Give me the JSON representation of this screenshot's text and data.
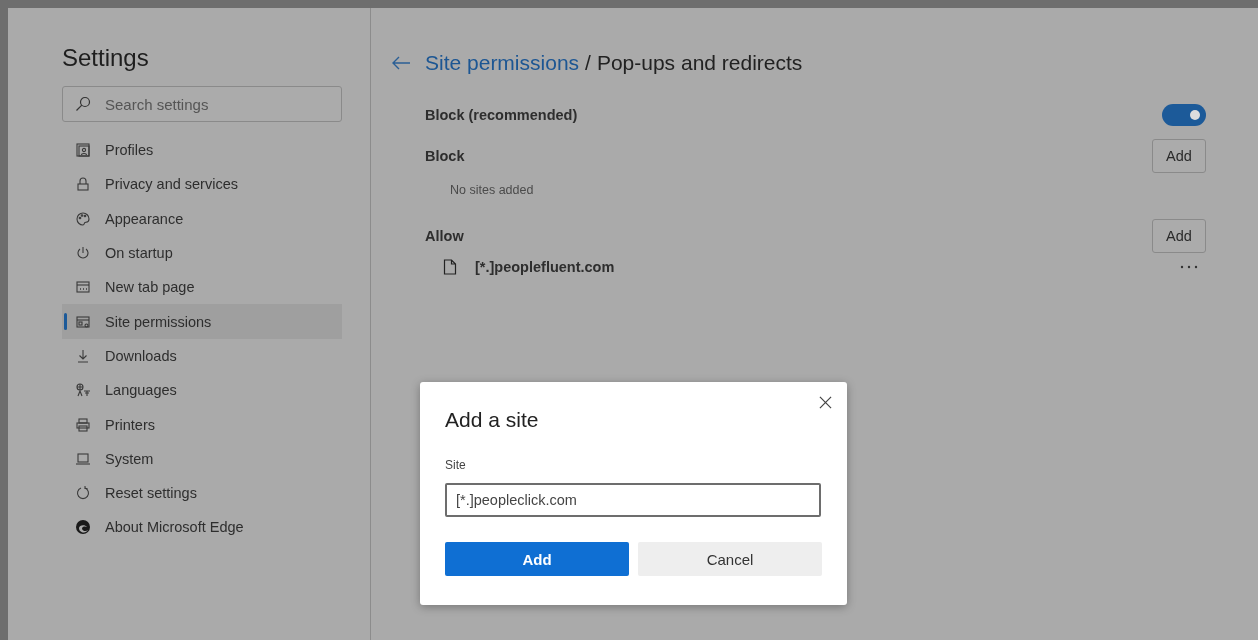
{
  "sidebar": {
    "title": "Settings",
    "search": {
      "placeholder": "Search settings"
    },
    "items": [
      {
        "label": "Profiles",
        "selected": false
      },
      {
        "label": "Privacy and services",
        "selected": false
      },
      {
        "label": "Appearance",
        "selected": false
      },
      {
        "label": "On startup",
        "selected": false
      },
      {
        "label": "New tab page",
        "selected": false
      },
      {
        "label": "Site permissions",
        "selected": true
      },
      {
        "label": "Downloads",
        "selected": false
      },
      {
        "label": "Languages",
        "selected": false
      },
      {
        "label": "Printers",
        "selected": false
      },
      {
        "label": "System",
        "selected": false
      },
      {
        "label": "Reset settings",
        "selected": false
      },
      {
        "label": "About Microsoft Edge",
        "selected": false
      }
    ]
  },
  "main": {
    "breadcrumb": {
      "link": "Site permissions",
      "separator": "/",
      "current": "Pop-ups and redirects"
    },
    "toggle_row": {
      "label": "Block (recommended)",
      "on": true
    },
    "sections": [
      {
        "title": "Block",
        "button": "Add",
        "empty_text": "No sites added"
      },
      {
        "title": "Allow",
        "button": "Add",
        "sites": [
          {
            "name": "[*.]peoplefluent.com"
          }
        ]
      }
    ]
  },
  "dialog": {
    "title": "Add a site",
    "field_label": "Site",
    "field_value": "[*.]peopleclick.com",
    "buttons": [
      {
        "label": "Add",
        "kind": "primary"
      },
      {
        "label": "Cancel",
        "kind": "secondary"
      }
    ]
  }
}
